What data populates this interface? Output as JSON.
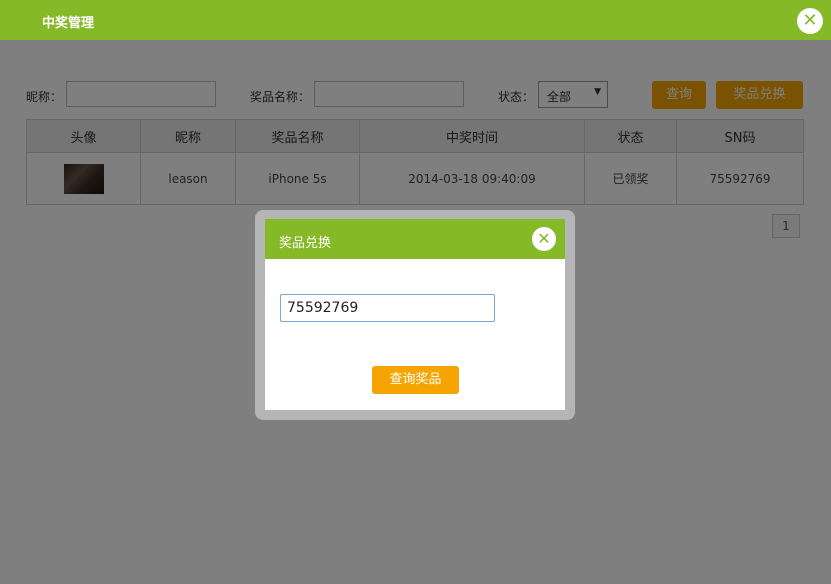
{
  "window": {
    "title": "中奖管理",
    "close_icon": "✕"
  },
  "filters": {
    "nickname_label": "昵称：",
    "nickname_value": "",
    "prize_label": "奖品名称：",
    "prize_value": "",
    "status_label": "状态：",
    "status_selected": "全部",
    "query_label": "查询",
    "exchange_label": "奖品兑换"
  },
  "table": {
    "headers": [
      "头像",
      "昵称",
      "奖品名称",
      "中奖时间",
      "状态",
      "SN码"
    ],
    "rows": [
      {
        "nickname": "leason",
        "prize": "iPhone 5s",
        "time": "2014-03-18 09:40:09",
        "status": "已领奖",
        "sn": "75592769"
      }
    ]
  },
  "pagination": {
    "current_page": "1"
  },
  "dialog": {
    "title": "奖品兑换",
    "close_icon": "✕",
    "sn_value": "75592769",
    "query_prize_label": "查询奖品"
  },
  "colors": {
    "header_green": "#86b928",
    "button_orange": "#f5a402",
    "overlay": "rgba(0,0,0,0.5)"
  }
}
